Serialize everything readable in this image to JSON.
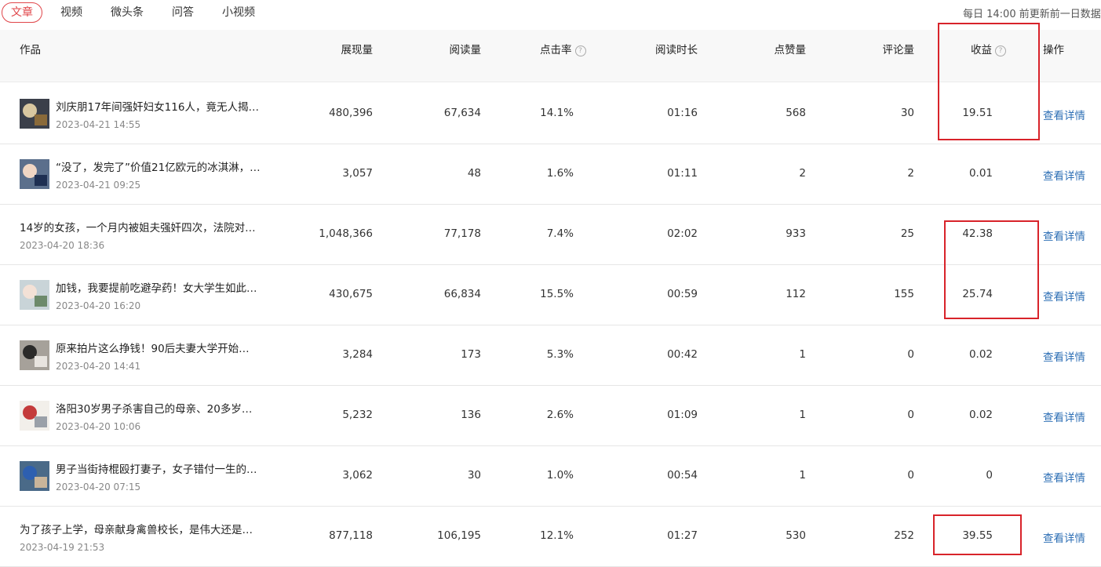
{
  "tabs": [
    "文章",
    "视频",
    "微头条",
    "问答",
    "小视频"
  ],
  "notice": "每日 14:00 前更新前一日数据",
  "headers": {
    "work": "作品",
    "impressions": "展现量",
    "reads": "阅读量",
    "ctr": "点击率",
    "duration": "阅读时长",
    "likes": "点赞量",
    "comments": "评论量",
    "income": "收益",
    "action": "操作",
    "help_mark": "?"
  },
  "rows": [
    {
      "title": "刘庆朋17年间强奸妇女116人，竟无人揭…",
      "date": "2023-04-21 14:55",
      "impressions": "480,396",
      "reads": "67,634",
      "ctr": "14.1%",
      "duration": "01:16",
      "likes": "568",
      "comments": "30",
      "income": "19.51",
      "action": "查看详情"
    },
    {
      "title": "“没了，发完了”价值21亿欧元的冰淇淋，…",
      "date": "2023-04-21 09:25",
      "impressions": "3,057",
      "reads": "48",
      "ctr": "1.6%",
      "duration": "01:11",
      "likes": "2",
      "comments": "2",
      "income": "0.01",
      "action": "查看详情"
    },
    {
      "title": "14岁的女孩，一个月内被姐夫强奸四次，法院对…",
      "date": "2023-04-20 18:36",
      "impressions": "1,048,366",
      "reads": "77,178",
      "ctr": "7.4%",
      "duration": "02:02",
      "likes": "933",
      "comments": "25",
      "income": "42.38",
      "action": "查看详情"
    },
    {
      "title": "加钱，我要提前吃避孕药！女大学生如此…",
      "date": "2023-04-20 16:20",
      "impressions": "430,675",
      "reads": "66,834",
      "ctr": "15.5%",
      "duration": "00:59",
      "likes": "112",
      "comments": "155",
      "income": "25.74",
      "action": "查看详情"
    },
    {
      "title": "原来拍片这么挣钱！90后夫妻大学开始…",
      "date": "2023-04-20 14:41",
      "impressions": "3,284",
      "reads": "173",
      "ctr": "5.3%",
      "duration": "00:42",
      "likes": "1",
      "comments": "0",
      "income": "0.02",
      "action": "查看详情"
    },
    {
      "title": "洛阳30岁男子杀害自己的母亲、20多岁…",
      "date": "2023-04-20 10:06",
      "impressions": "5,232",
      "reads": "136",
      "ctr": "2.6%",
      "duration": "01:09",
      "likes": "1",
      "comments": "0",
      "income": "0.02",
      "action": "查看详情"
    },
    {
      "title": "男子当街持棍殴打妻子，女子错付一生的…",
      "date": "2023-04-20 07:15",
      "impressions": "3,062",
      "reads": "30",
      "ctr": "1.0%",
      "duration": "00:54",
      "likes": "1",
      "comments": "0",
      "income": "0",
      "action": "查看详情"
    },
    {
      "title": "为了孩子上学，母亲献身禽兽校长，是伟大还是…",
      "date": "2023-04-19 21:53",
      "impressions": "877,118",
      "reads": "106,195",
      "ctr": "12.1%",
      "duration": "01:27",
      "likes": "530",
      "comments": "252",
      "income": "39.55",
      "action": "查看详情"
    }
  ],
  "colors": {
    "accent": "#e0464a",
    "link": "#2e6fb5",
    "highlight": "#d8232a"
  },
  "icons": {
    "help": "question-circle-icon"
  }
}
